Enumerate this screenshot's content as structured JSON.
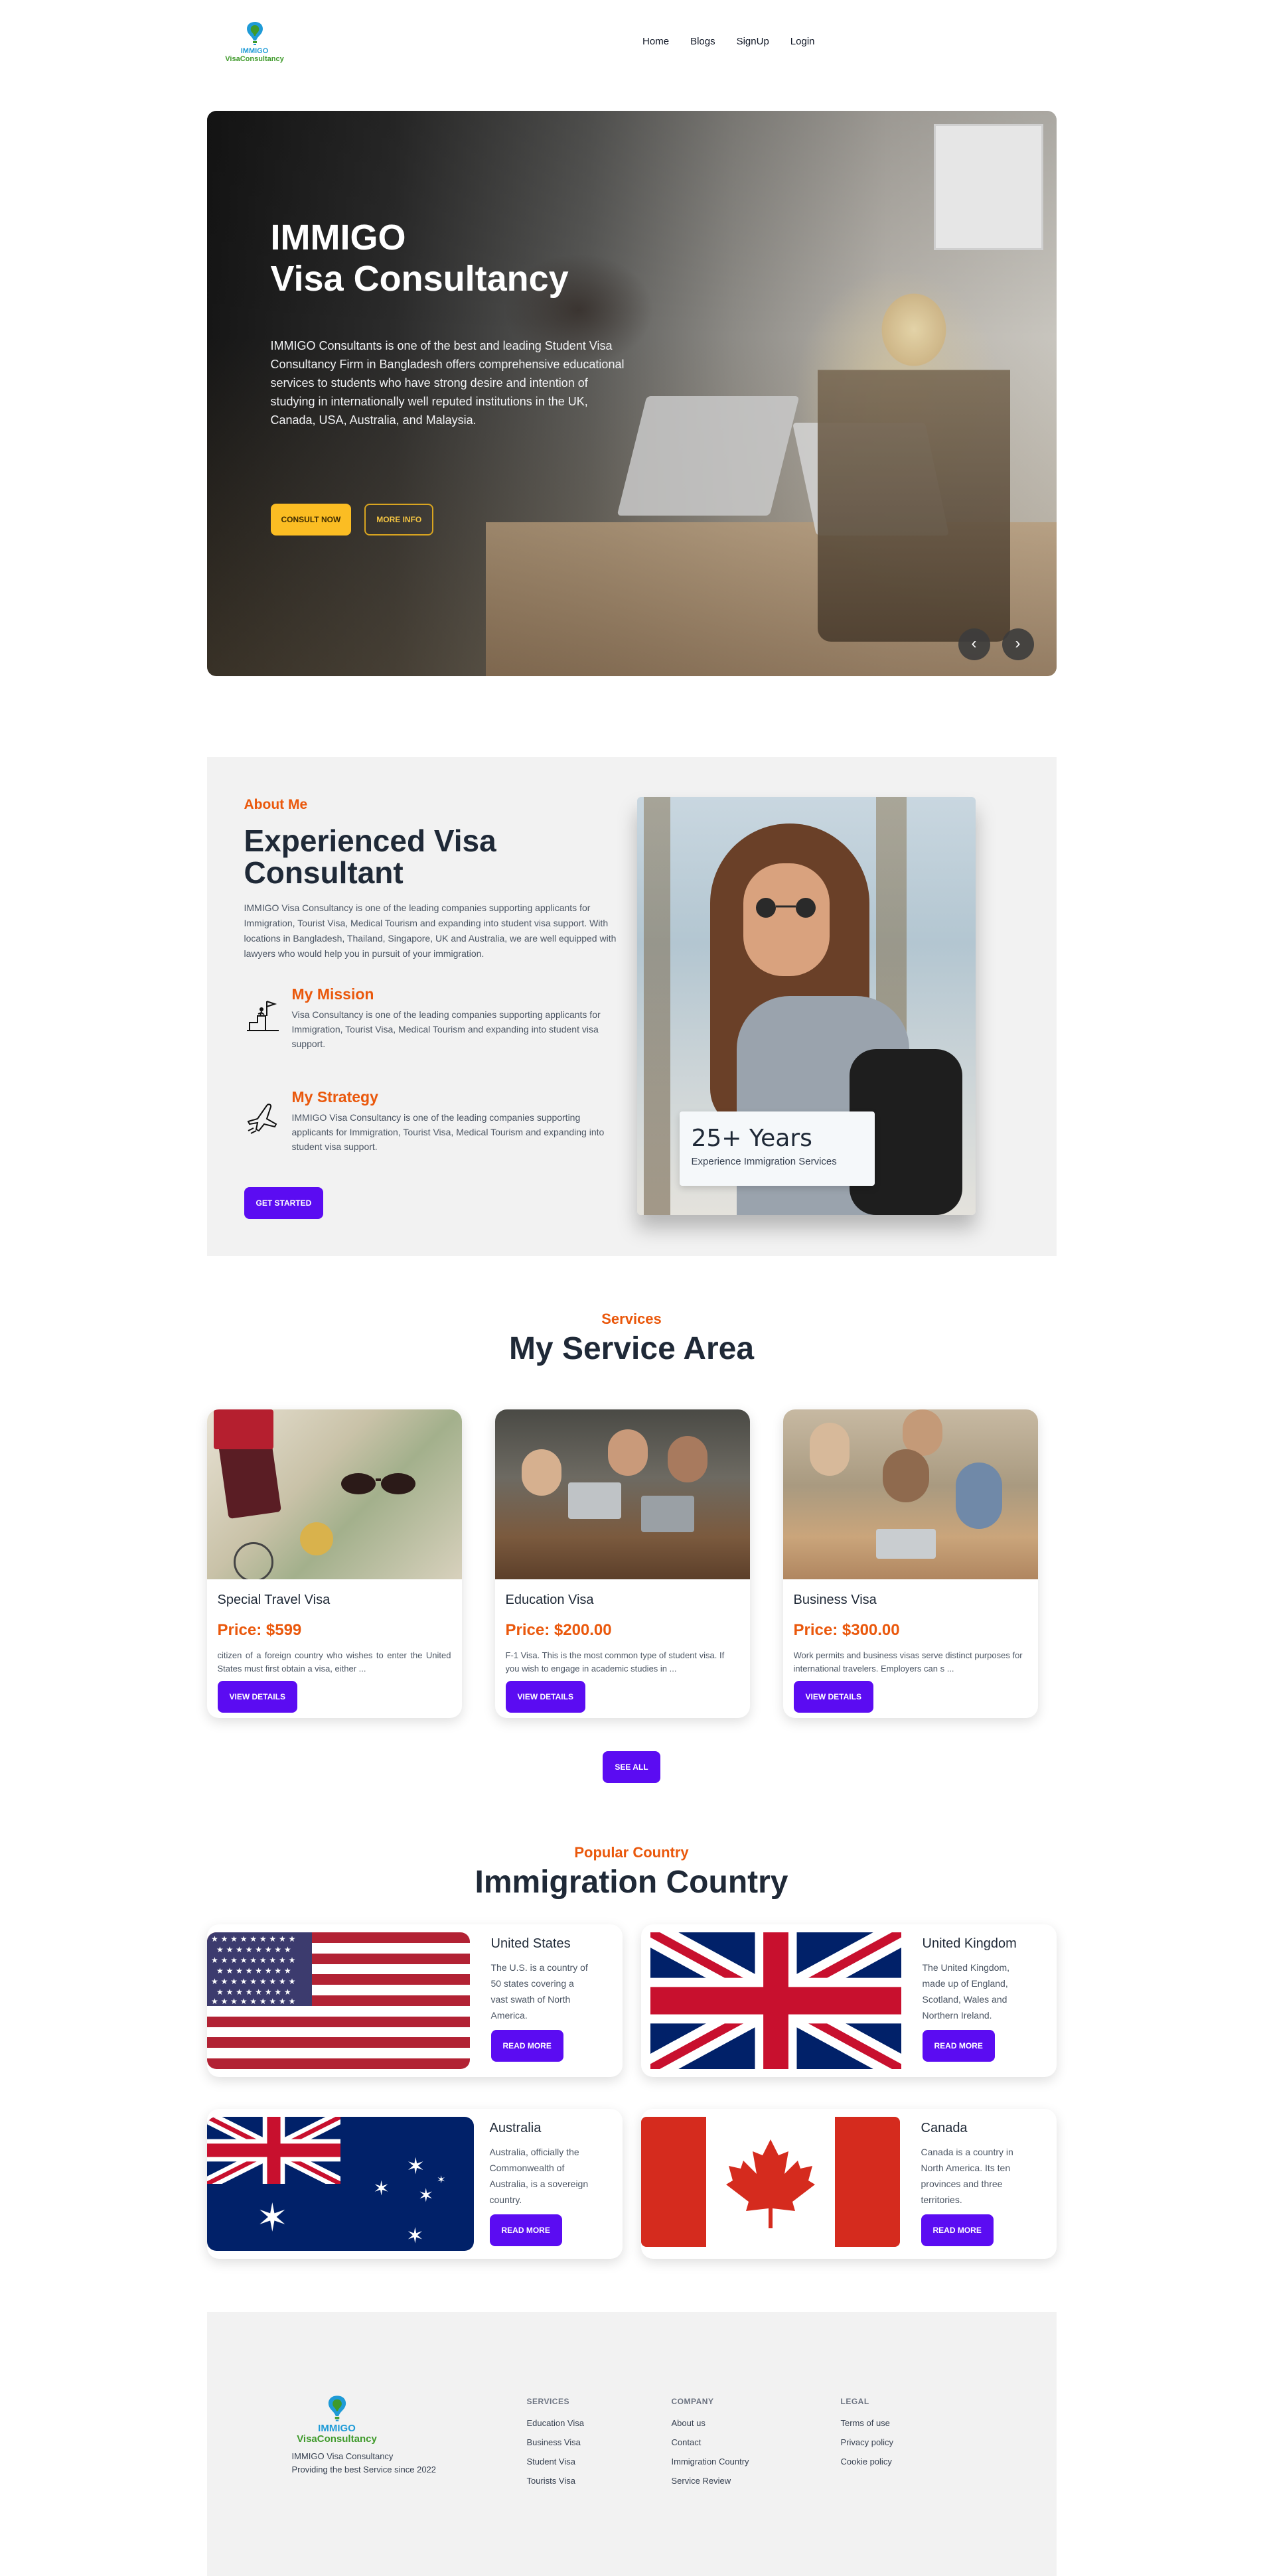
{
  "brand": {
    "line1": "IMMIGO",
    "line2": "VisaConsultancy"
  },
  "nav": {
    "links": [
      "Home",
      "Blogs",
      "SignUp",
      "Login"
    ]
  },
  "hero": {
    "title_line1": "IMMIGO",
    "title_line2": "Visa Consultancy",
    "description": "IMMIGO Consultants is one of the best and leading Student Visa Consultancy Firm in Bangladesh offers comprehensive educational services to students who have strong desire and intention of studying in internationally well reputed institutions in the UK, Canada, USA, Australia, and Malaysia.",
    "btn_consult": "CONSULT NOW",
    "btn_more": "MORE INFO",
    "prev": "‹",
    "next": "›"
  },
  "about": {
    "kicker": "About Me",
    "title": "Experienced Visa Consultant",
    "description": "IMMIGO Visa Consultancy is one of the leading companies supporting applicants for Immigration, Tourist Visa, Medical Tourism and expanding into student visa support. With locations in Bangladesh, Thailand, Singapore, UK and Australia, we are well equipped with lawyers who would help you in pursuit of your immigration.",
    "mission_title": "My Mission",
    "mission_text": "Visa Consultancy is one of the leading companies supporting applicants for Immigration, Tourist Visa, Medical Tourism and expanding into student visa support.",
    "strategy_title": "My Strategy",
    "strategy_text": "IMMIGO Visa Consultancy is one of the leading companies supporting applicants for Immigration, Tourist Visa, Medical Tourism and expanding into student visa support.",
    "button": "GET STARTED",
    "badge_big": "25+ Years",
    "badge_small": "Experience Immigration Services"
  },
  "services": {
    "kicker": "Services",
    "title": "My Service Area",
    "cards": [
      {
        "title": "Special Travel Visa",
        "price": "Price: $599",
        "desc": "citizen of a foreign country who wishes to enter the United States must first obtain a visa, either ...",
        "button": "VIEW DETAILS"
      },
      {
        "title": "Education Visa",
        "price": "Price: $200.00",
        "desc": "F-1 Visa. This is the most common type of student visa. If you wish to engage in academic studies in ...",
        "button": "VIEW DETAILS"
      },
      {
        "title": "Business Visa",
        "price": "Price: $300.00",
        "desc": "Work permits and business visas serve distinct purposes for international travelers. Employers can s ...",
        "button": "VIEW DETAILS"
      }
    ],
    "see_all": "SEE ALL"
  },
  "countries": {
    "kicker": "Popular Country",
    "title": "Immigration Country",
    "items": [
      {
        "name": "United States",
        "desc": "The U.S. is a country of 50 states covering a vast swath of North America.",
        "button": "READ MORE"
      },
      {
        "name": "United Kingdom",
        "desc": "The United Kingdom, made up of England, Scotland, Wales and Northern Ireland.",
        "button": "READ MORE"
      },
      {
        "name": "Australia",
        "desc": "Australia, officially the Commonwealth of Australia, is a sovereign country.",
        "button": "READ MORE"
      },
      {
        "name": "Canada",
        "desc": "Canada is a country in North America. Its ten provinces and three territories.",
        "button": "READ MORE"
      }
    ]
  },
  "footer": {
    "tagline1": "IMMIGO Visa Consultancy",
    "tagline2": "Providing the best Service since 2022",
    "services_title": "SERVICES",
    "services_links": [
      "Education Visa",
      "Business Visa",
      "Student Visa",
      "Tourists Visa"
    ],
    "company_title": "COMPANY",
    "company_links": [
      "About us",
      "Contact",
      "Immigration Country",
      "Service Review"
    ],
    "legal_title": "LEGAL",
    "legal_links": [
      "Terms of use",
      "Privacy policy",
      "Cookie policy"
    ]
  },
  "colors": {
    "accent": "#5b0cf2",
    "orange": "#ea580c",
    "yellow": "#fbbd23"
  }
}
